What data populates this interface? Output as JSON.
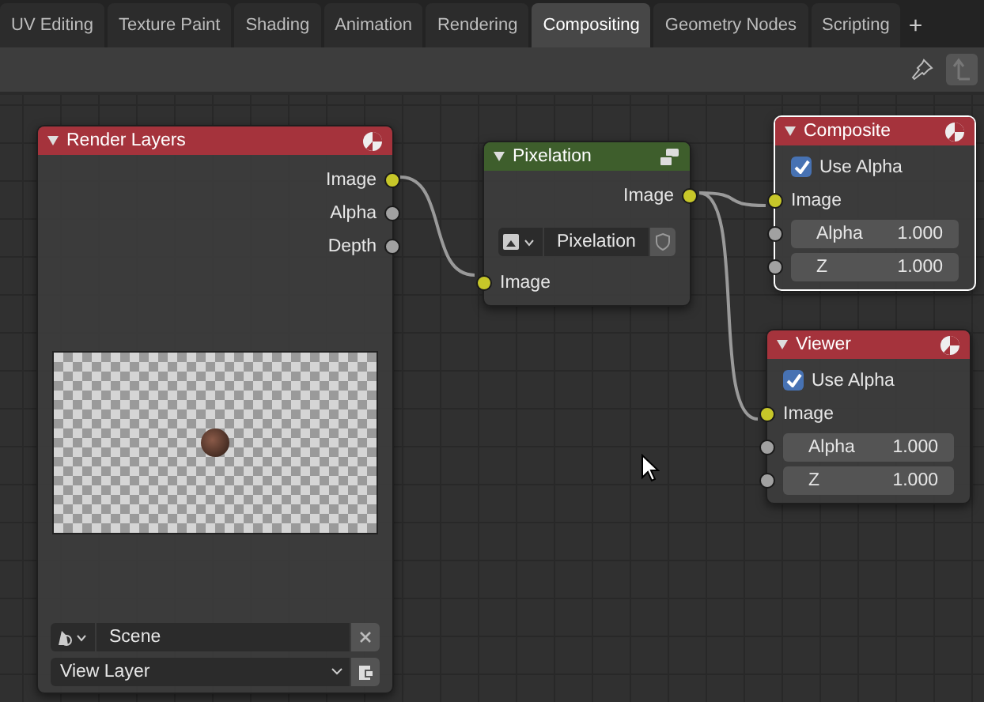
{
  "tabs": [
    {
      "label": "UV Editing",
      "selected": false
    },
    {
      "label": "Texture Paint",
      "selected": false
    },
    {
      "label": "Shading",
      "selected": false
    },
    {
      "label": "Animation",
      "selected": false
    },
    {
      "label": "Rendering",
      "selected": false
    },
    {
      "label": "Compositing",
      "selected": true
    },
    {
      "label": "Geometry Nodes",
      "selected": false
    },
    {
      "label": "Scripting",
      "selected": false
    }
  ],
  "add_tab": "+",
  "nodes": [
    {
      "title": "Render Layers",
      "color": "#a5333c",
      "selected": false,
      "outputs": [
        {
          "label": "Image",
          "kind": "color"
        },
        {
          "label": "Alpha",
          "kind": "value"
        },
        {
          "label": "Depth",
          "kind": "value"
        }
      ],
      "preview": true,
      "scene": {
        "value": "Scene"
      },
      "view_layer": {
        "value": "View Layer"
      }
    },
    {
      "title": "Pixelation",
      "color": "#3e5e2c",
      "selected": false,
      "outputs": [
        {
          "label": "Image",
          "kind": "color"
        }
      ],
      "group": {
        "value": "Pixelation"
      },
      "inputs": [
        {
          "label": "Image",
          "kind": "color"
        }
      ]
    },
    {
      "title": "Composite",
      "color": "#a5333c",
      "selected": true,
      "use_alpha": {
        "label": "Use Alpha",
        "checked": true
      },
      "inputs": [
        {
          "label": "Image",
          "kind": "color"
        },
        {
          "label": "Alpha",
          "kind": "value",
          "value": "1.000"
        },
        {
          "label": "Z",
          "kind": "value",
          "value": "1.000"
        }
      ]
    },
    {
      "title": "Viewer",
      "color": "#a5333c",
      "selected": false,
      "use_alpha": {
        "label": "Use Alpha",
        "checked": true
      },
      "inputs": [
        {
          "label": "Image",
          "kind": "color"
        },
        {
          "label": "Alpha",
          "kind": "value",
          "value": "1.000"
        },
        {
          "label": "Z",
          "kind": "value",
          "value": "1.000"
        }
      ]
    }
  ]
}
